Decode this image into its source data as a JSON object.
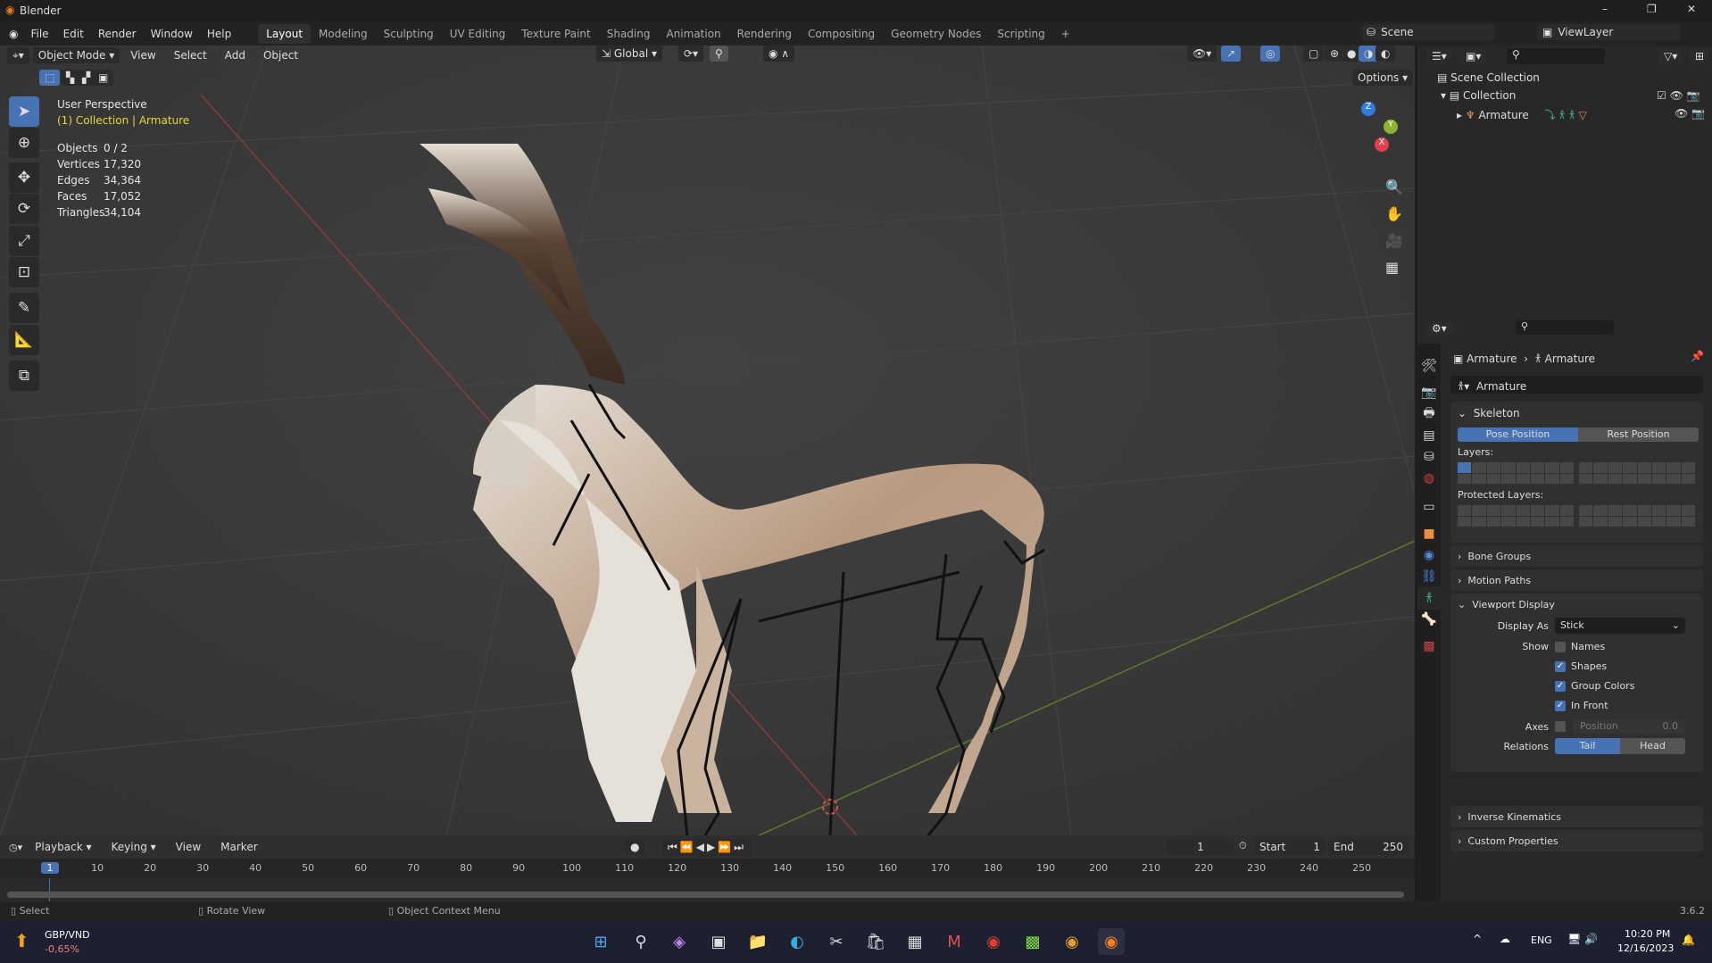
{
  "window": {
    "title": "Blender",
    "min": "–",
    "max": "❐",
    "close": "✕"
  },
  "menu": [
    "File",
    "Edit",
    "Render",
    "Window",
    "Help"
  ],
  "workspaces": [
    "Layout",
    "Modeling",
    "Sculpting",
    "UV Editing",
    "Texture Paint",
    "Shading",
    "Animation",
    "Rendering",
    "Compositing",
    "Geometry Nodes",
    "Scripting",
    "+"
  ],
  "scene": "Scene",
  "view_layer": "ViewLayer",
  "viewport": {
    "mode": "Object Mode",
    "menus": [
      "View",
      "Select",
      "Add",
      "Object"
    ],
    "orientation": "Global",
    "options": "Options",
    "perspective": "User Perspective",
    "context": "(1) Collection | Armature",
    "stats": [
      [
        "Objects",
        "0 / 2"
      ],
      [
        "Vertices",
        "17,320"
      ],
      [
        "Edges",
        "34,364"
      ],
      [
        "Faces",
        "17,052"
      ],
      [
        "Triangles",
        "34,104"
      ]
    ],
    "axes": [
      "Z",
      "Y",
      "X"
    ]
  },
  "outliner": {
    "root": "Scene Collection",
    "collection": "Collection",
    "item": "Armature"
  },
  "props": {
    "breadcrumb": [
      "Armature",
      "Armature"
    ],
    "datablock": "Armature",
    "skeleton": "Skeleton",
    "pose": "Pose Position",
    "rest": "Rest Position",
    "layers": "Layers:",
    "protected": "Protected Layers:",
    "bone_groups": "Bone Groups",
    "motion_paths": "Motion Paths",
    "viewport_display": "Viewport Display",
    "display_as_label": "Display As",
    "display_as": "Stick",
    "show": "Show",
    "checks": [
      {
        "label": "Names",
        "on": false
      },
      {
        "label": "Shapes",
        "on": true
      },
      {
        "label": "Group Colors",
        "on": true
      },
      {
        "label": "In Front",
        "on": true
      }
    ],
    "axes": "Axes",
    "position": "Position",
    "position_val": "0.0",
    "relations": "Relations",
    "tail": "Tail",
    "head": "Head",
    "ik": "Inverse Kinematics",
    "custom": "Custom Properties"
  },
  "timeline": {
    "menus": [
      "Playback",
      "Keying",
      "View",
      "Marker"
    ],
    "current": "1",
    "start_label": "Start",
    "start": "1",
    "end_label": "End",
    "end": "250",
    "ticks": [
      "1",
      "10",
      "20",
      "30",
      "40",
      "50",
      "60",
      "70",
      "80",
      "90",
      "100",
      "110",
      "120",
      "130",
      "140",
      "150",
      "160",
      "170",
      "180",
      "190",
      "200",
      "210",
      "220",
      "230",
      "240",
      "250"
    ]
  },
  "status": {
    "select": "Select",
    "rotate": "Rotate View",
    "context": "Object Context Menu",
    "version": "3.6.2"
  },
  "taskbar": {
    "ticker": "GBP/VND",
    "change": "-0,65%",
    "lang": "ENG",
    "time": "10:20 PM",
    "date": "12/16/2023"
  }
}
